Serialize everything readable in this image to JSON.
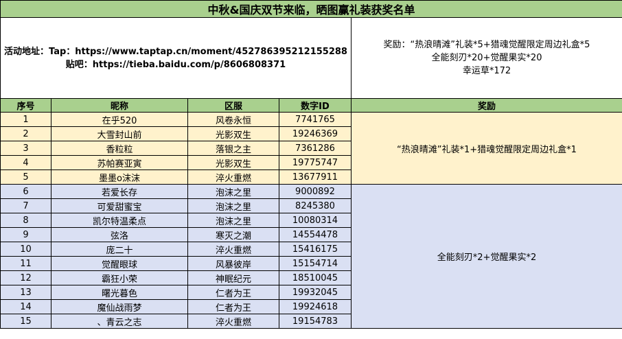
{
  "title": "中秋&国庆双节来临，晒图赢礼装获奖名单",
  "info": {
    "tap_line": "活动地址：Tap：https://www.taptap.cn/moment/452786395212155288",
    "tieba_line": "贴吧：https://tieba.baidu.com/p/8606808371",
    "reward_line1": "奖励：“热浪晴滩”礼装*5+猎魂觉醒限定周边礼盒*5",
    "reward_line2": "全能刻刃*20+觉醒果实*20",
    "reward_line3": "幸运草*172"
  },
  "columns": [
    "序号",
    "昵称",
    "区服",
    "数字ID",
    "奖励"
  ],
  "rows": [
    {
      "no": "1",
      "nick": "在乎520",
      "server": "风卷永恒",
      "id": "7741765"
    },
    {
      "no": "2",
      "nick": "大雪封山前",
      "server": "光影双生",
      "id": "19246369"
    },
    {
      "no": "3",
      "nick": "香粒粒",
      "server": "落银之主",
      "id": "7361286"
    },
    {
      "no": "4",
      "nick": "苏帕赛亚寅",
      "server": "光影双生",
      "id": "19775747"
    },
    {
      "no": "5",
      "nick": "墨墨o沫沫",
      "server": "淬火重燃",
      "id": "13677911"
    },
    {
      "no": "6",
      "nick": "若爱长存",
      "server": "泡沫之里",
      "id": "9000892"
    },
    {
      "no": "7",
      "nick": "可爱甜蜜宝",
      "server": "泡沫之里",
      "id": "8245380"
    },
    {
      "no": "8",
      "nick": "凯尔特温柔点",
      "server": "泡沫之里",
      "id": "10080314"
    },
    {
      "no": "9",
      "nick": "弦洛",
      "server": "寒灭之潮",
      "id": "14554478"
    },
    {
      "no": "10",
      "nick": "庞二十",
      "server": "淬火重燃",
      "id": "15416175"
    },
    {
      "no": "11",
      "nick": "觉醒眼球",
      "server": "风暴彼岸",
      "id": "15154714"
    },
    {
      "no": "12",
      "nick": "霸狂小荣",
      "server": "神眠纪元",
      "id": "18510045"
    },
    {
      "no": "13",
      "nick": "曙光暮色",
      "server": "仁者为王",
      "id": "19932045"
    },
    {
      "no": "14",
      "nick": "魔仙战雨梦",
      "server": "仁者为王",
      "id": "19924618"
    },
    {
      "no": "15",
      "nick": "、青云之志",
      "server": "淬火重燃",
      "id": "19154783"
    }
  ],
  "group_rewards": {
    "group1": "“热浪晴滩”礼装*1+猎魂觉醒限定周边礼盒*1",
    "group2": "全能刻刃*2+觉醒果实*2"
  },
  "colors": {
    "header_green": "#a9d08e",
    "group1_fill": "#fff2cc",
    "group2_fill": "#dae0f3"
  }
}
